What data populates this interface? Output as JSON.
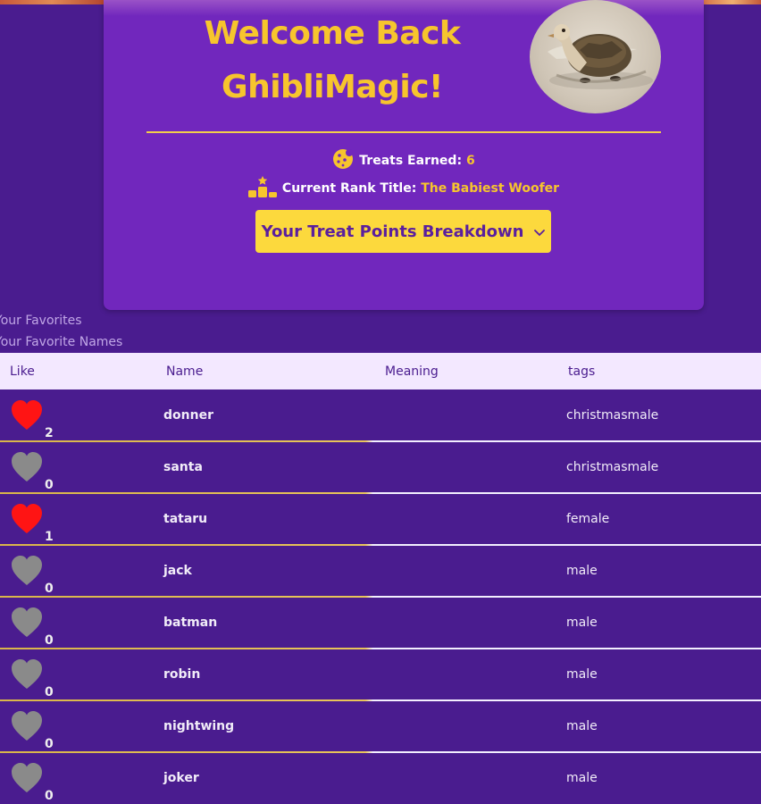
{
  "header": {
    "welcome_line1": "Welcome Back",
    "welcome_line2": "GhibliMagic!",
    "treats_label": "Treats Earned:",
    "treats_value": "6",
    "rank_label": "Current Rank Title:",
    "rank_value": "The Babiest Woofer",
    "breakdown_button": "Your Treat Points Breakdown"
  },
  "favorites": {
    "heading": "Your Favorites",
    "subheading": "Your Favorite Names",
    "columns": [
      "Like",
      "Name",
      "Meaning",
      "tags"
    ],
    "rows": [
      {
        "liked": true,
        "count": "2",
        "name": "donner",
        "meaning": "",
        "tags": "christmasmale"
      },
      {
        "liked": false,
        "count": "0",
        "name": "santa",
        "meaning": "",
        "tags": "christmasmale"
      },
      {
        "liked": true,
        "count": "1",
        "name": "tataru",
        "meaning": "",
        "tags": "female"
      },
      {
        "liked": false,
        "count": "0",
        "name": "jack",
        "meaning": "",
        "tags": "male"
      },
      {
        "liked": false,
        "count": "0",
        "name": "batman",
        "meaning": "",
        "tags": "male"
      },
      {
        "liked": false,
        "count": "0",
        "name": "robin",
        "meaning": "",
        "tags": "male"
      },
      {
        "liked": false,
        "count": "0",
        "name": "nightwing",
        "meaning": "",
        "tags": "male"
      },
      {
        "liked": false,
        "count": "0",
        "name": "joker",
        "meaning": "",
        "tags": "male"
      }
    ]
  },
  "colors": {
    "background": "#4a1c8f",
    "card": "#7127bd",
    "accent_yellow": "#f7c52d",
    "heart_liked": "#ff1414",
    "heart_unliked": "#8a8a8a"
  },
  "icons": {
    "treats": "cookie-icon",
    "rank": "podium-icon",
    "dropdown": "chevron-down-icon",
    "like": "heart-icon"
  }
}
